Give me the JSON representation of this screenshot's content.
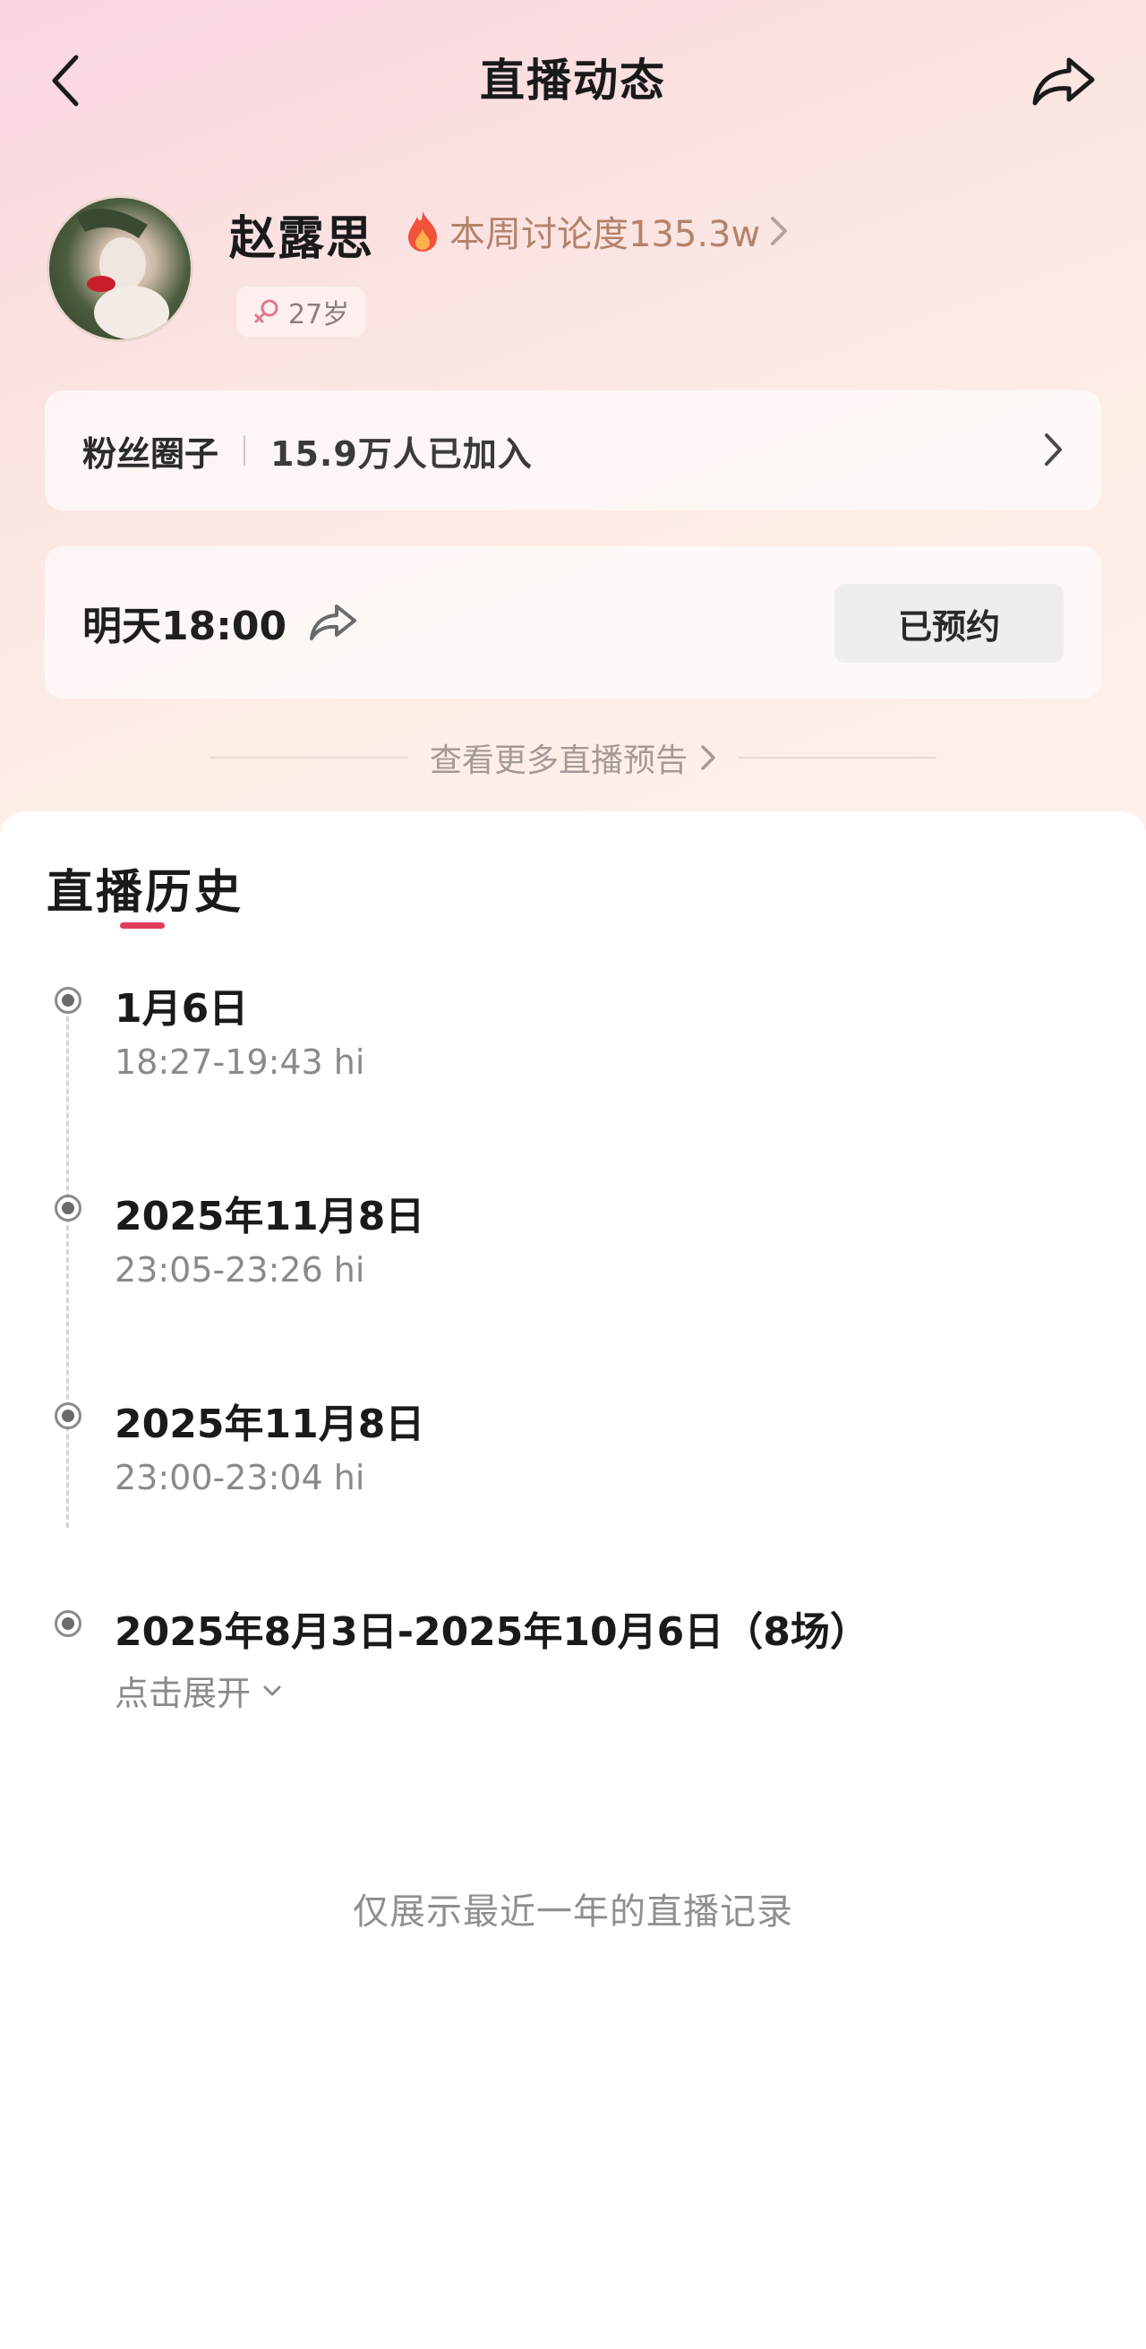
{
  "header": {
    "title": "直播动态",
    "back_icon": "back-chevron-icon",
    "share_icon": "share-arrow-icon"
  },
  "profile": {
    "name": "赵露思",
    "heat_label": "本周讨论度135.3w",
    "age": "27岁",
    "accent_color": "#e03a5c"
  },
  "fan_circle": {
    "label": "粉丝圈子",
    "count": "15.9万人已加入"
  },
  "upcoming_live": {
    "time": "明天18:00",
    "reserve_label": "已预约"
  },
  "more_preview": {
    "label": "查看更多直播预告"
  },
  "history": {
    "title": "直播历史",
    "items": [
      {
        "date": "1月6日",
        "time": "18:27-19:43 hi"
      },
      {
        "date": "2025年11月8日",
        "time": "23:05-23:26 hi"
      },
      {
        "date": "2025年11月8日",
        "time": "23:00-23:04 hi"
      },
      {
        "date": "2025年8月3日-2025年10月6日（8场）",
        "expand_label": "点击展开"
      }
    ],
    "footnote": "仅展示最近一年的直播记录"
  }
}
